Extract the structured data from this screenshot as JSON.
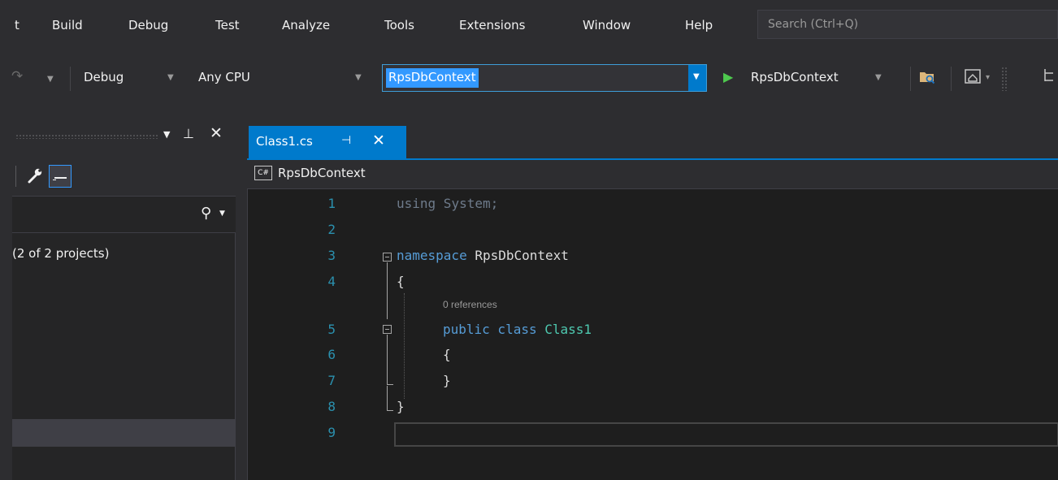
{
  "menu": {
    "items": [
      "t",
      "Build",
      "Debug",
      "Test",
      "Analyze",
      "Tools",
      "Extensions",
      "Window",
      "Help"
    ],
    "search_placeholder": "Search (Ctrl+Q)"
  },
  "toolbar": {
    "configuration": "Debug",
    "platform": "Any CPU",
    "startup_project": "RpsDbContext",
    "start_label": "RpsDbContext"
  },
  "solution_explorer": {
    "tree_text": "(2 of 2 projects)"
  },
  "editor": {
    "tab": {
      "label": "Class1.cs",
      "pin_glyph": "⊣",
      "close_glyph": "✕"
    },
    "nav": {
      "badge": "C#",
      "type": "RpsDbContext"
    },
    "line_numbers": [
      "1",
      "2",
      "3",
      "4",
      "5",
      "6",
      "7",
      "8",
      "9"
    ],
    "code": {
      "l1_kw": "using",
      "l1_rest": " System;",
      "l3_kw": "namespace",
      "l3_name": " RpsDbContext",
      "l4": "{",
      "codelens": "0 references",
      "l5_kw1": "public",
      "l5_kw2": " class",
      "l5_type": " Class1",
      "l6": "{",
      "l7": "}",
      "l8": "}"
    }
  },
  "colors": {
    "accent": "#007acc",
    "keyword": "#569cd6",
    "type": "#4ec9b0",
    "line_number": "#2b91af",
    "editor_bg": "#1e1e1e",
    "chrome_bg": "#2d2d30"
  }
}
